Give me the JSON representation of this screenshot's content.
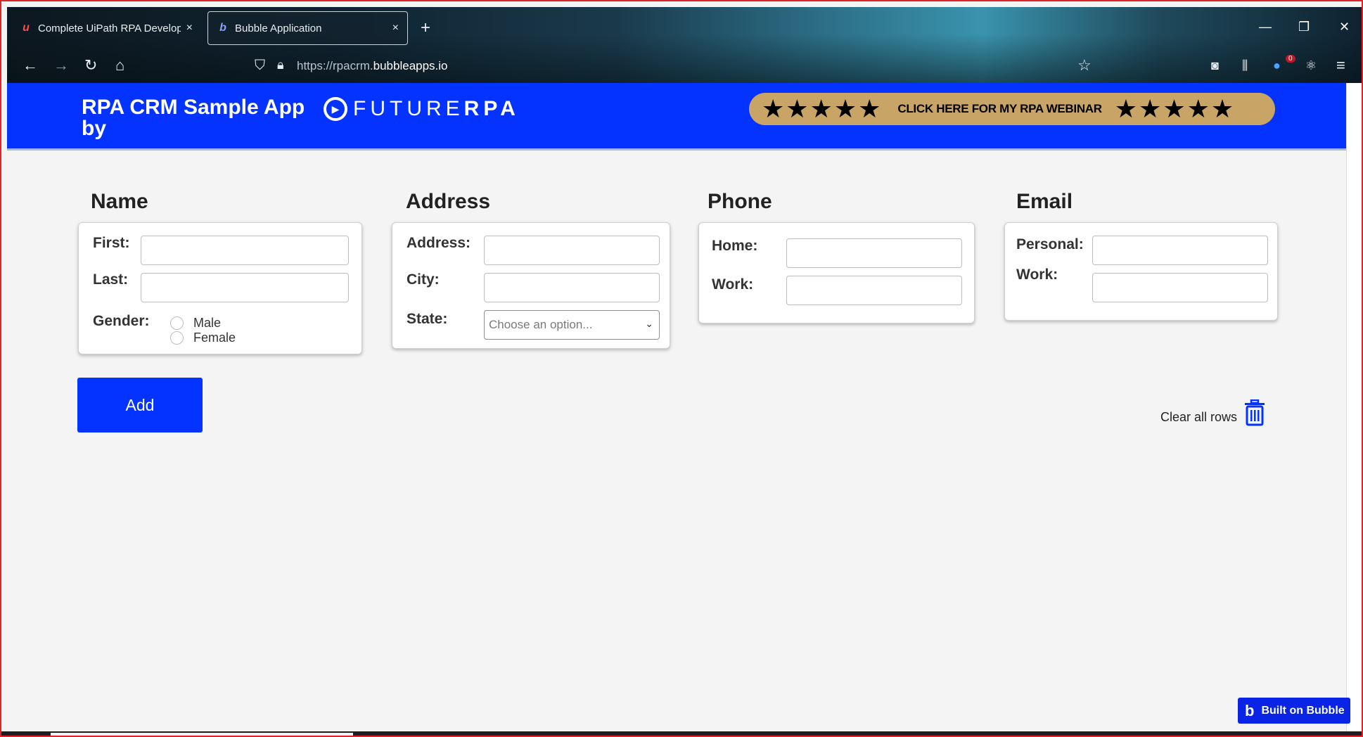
{
  "browser": {
    "tabs": [
      {
        "title": "Complete UiPath RPA Develope",
        "favicon": "u-logo",
        "close": "×"
      },
      {
        "title": "Bubble Application",
        "favicon": "bubble-logo",
        "close": "×"
      }
    ],
    "new_tab": "+",
    "url_prefix": "https://rpacrm.",
    "url_domain": "bubbleapps.io",
    "extension_badge": "0"
  },
  "header": {
    "title_line1": "RPA CRM Sample App",
    "title_line2": "by",
    "logo_future": "FUTURE",
    "logo_rpa": "RPA",
    "webinar_text": "CLICK HERE FOR MY RPA WEBINAR",
    "stars": "★★★★★"
  },
  "name_section": {
    "title": "Name",
    "first_label": "First:",
    "last_label": "Last:",
    "gender_label": "Gender:",
    "options": [
      "Male",
      "Female"
    ]
  },
  "address_section": {
    "title": "Address",
    "address_label": "Address:",
    "city_label": "City:",
    "state_label": "State:",
    "state_placeholder": "Choose an option..."
  },
  "phone_section": {
    "title": "Phone",
    "home_label": "Home:",
    "work_label": "Work:"
  },
  "email_section": {
    "title": "Email",
    "personal_label": "Personal:",
    "work_label": "Work:"
  },
  "actions": {
    "add_label": "Add",
    "clear_label": "Clear all rows"
  },
  "footer": {
    "bubble_badge": "Built on Bubble"
  },
  "colors": {
    "brand_blue": "#0433ff",
    "webinar_gold": "#c8a566"
  }
}
